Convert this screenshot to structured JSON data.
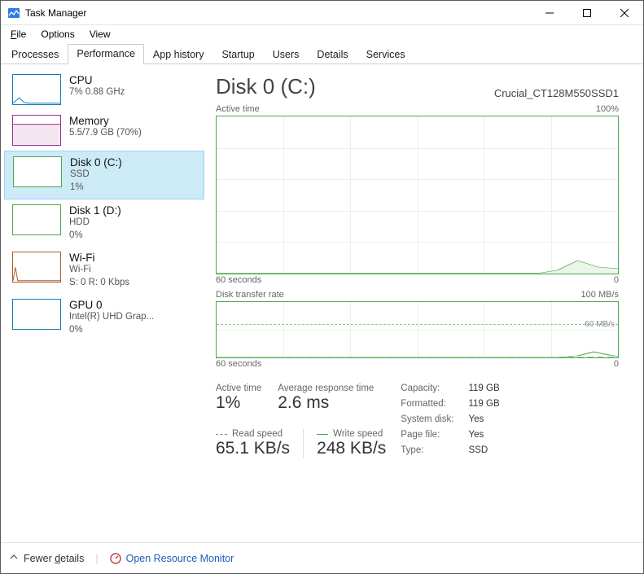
{
  "window": {
    "title": "Task Manager"
  },
  "menu": {
    "file": "File",
    "options": "Options",
    "view": "View"
  },
  "tabs": {
    "processes": "Processes",
    "performance": "Performance",
    "app_history": "App history",
    "startup": "Startup",
    "users": "Users",
    "details": "Details",
    "services": "Services"
  },
  "sidebar": {
    "items": [
      {
        "title": "CPU",
        "sub1": "7% 0.88 GHz",
        "sub2": ""
      },
      {
        "title": "Memory",
        "sub1": "5.5/7.9 GB (70%)",
        "sub2": ""
      },
      {
        "title": "Disk 0 (C:)",
        "sub1": "SSD",
        "sub2": "1%"
      },
      {
        "title": "Disk 1 (D:)",
        "sub1": "HDD",
        "sub2": "0%"
      },
      {
        "title": "Wi-Fi",
        "sub1": "Wi-Fi",
        "sub2": "S: 0 R: 0 Kbps"
      },
      {
        "title": "GPU 0",
        "sub1": "Intel(R) UHD Grap...",
        "sub2": "0%"
      }
    ]
  },
  "detail": {
    "title": "Disk 0 (C:)",
    "model": "Crucial_CT128M550SSD1",
    "chart1_label": "Active time",
    "chart1_max": "100%",
    "chart1_x_left": "60 seconds",
    "chart1_x_right": "0",
    "chart2_label": "Disk transfer rate",
    "chart2_max": "100 MB/s",
    "chart2_mid": "60 MB/s",
    "chart2_x_left": "60 seconds",
    "chart2_x_right": "0",
    "stats": {
      "active_time_label": "Active time",
      "active_time": "1%",
      "avg_label": "Average response time",
      "avg": "2.6 ms",
      "read_label": "Read speed",
      "read": "65.1 KB/s",
      "write_label": "Write speed",
      "write": "248 KB/s"
    },
    "kv": {
      "capacity_l": "Capacity:",
      "capacity": "119 GB",
      "formatted_l": "Formatted:",
      "formatted": "119 GB",
      "sysdisk_l": "System disk:",
      "sysdisk": "Yes",
      "pagefile_l": "Page file:",
      "pagefile": "Yes",
      "type_l": "Type:",
      "type": "SSD"
    }
  },
  "footer": {
    "fewer": "Fewer details",
    "orm": "Open Resource Monitor"
  },
  "chart_data": [
    {
      "type": "line",
      "title": "Active time",
      "xlabel_left": "60 seconds",
      "xlabel_right": "0",
      "ylabel": "%",
      "ylim": [
        0,
        100
      ],
      "x": [
        0,
        5,
        10,
        15,
        20,
        25,
        30,
        35,
        40,
        45,
        50,
        55,
        60
      ],
      "series": [
        {
          "name": "Active time",
          "values": [
            0,
            0,
            0,
            0,
            0,
            0,
            0,
            0,
            0,
            0,
            2,
            8,
            3
          ]
        }
      ]
    },
    {
      "type": "line",
      "title": "Disk transfer rate",
      "xlabel_left": "60 seconds",
      "xlabel_right": "0",
      "ylabel": "MB/s",
      "ylim": [
        0,
        100
      ],
      "reference_line": 60,
      "x": [
        0,
        5,
        10,
        15,
        20,
        25,
        30,
        35,
        40,
        45,
        50,
        55,
        60
      ],
      "series": [
        {
          "name": "Read speed",
          "style": "dashed",
          "values": [
            0,
            0,
            0,
            0,
            0,
            0,
            0,
            0,
            0,
            0,
            0,
            1,
            0
          ]
        },
        {
          "name": "Write speed",
          "style": "solid",
          "values": [
            0,
            0,
            0,
            0,
            0,
            0,
            0,
            0,
            0,
            0,
            3,
            10,
            2
          ]
        }
      ]
    }
  ]
}
